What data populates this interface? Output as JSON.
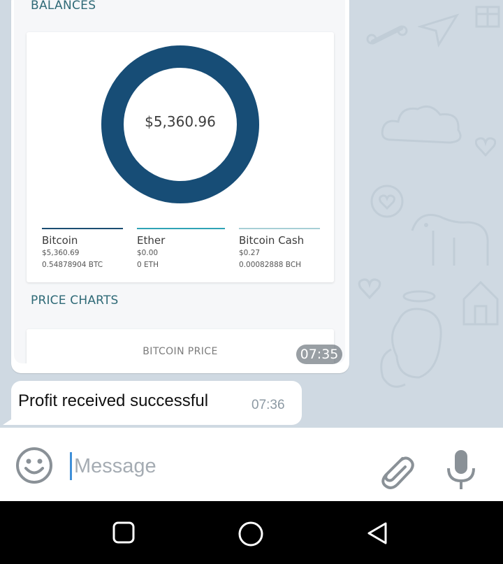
{
  "screenshot_message": {
    "balances_heading": "BALANCES",
    "total": "$5,360.96",
    "coins": [
      {
        "name": "Bitcoin",
        "usd": "$5,360.69",
        "amount": "0.54878904 BTC",
        "color": "#1a4d72"
      },
      {
        "name": "Ether",
        "usd": "$0.00",
        "amount": "0 ETH",
        "color": "#2fa3b6"
      },
      {
        "name": "Bitcoin Cash",
        "usd": "$0.27",
        "amount": "0.00082888 BCH",
        "color": "#a7cfd6"
      }
    ],
    "donut_color": "#174d76",
    "price_charts_heading": "PRICE CHARTS",
    "price_chart_title": "BITCOIN PRICE",
    "time": "07:35"
  },
  "text_message": {
    "text": "Profit received successful",
    "time": "07:36"
  },
  "input": {
    "placeholder": "Message",
    "value": ""
  },
  "icons": {
    "emoji": "smiley-icon",
    "attach": "paperclip-icon",
    "mic": "microphone-icon",
    "nav_recents": "square-icon",
    "nav_home": "circle-icon",
    "nav_back": "triangle-back-icon"
  }
}
